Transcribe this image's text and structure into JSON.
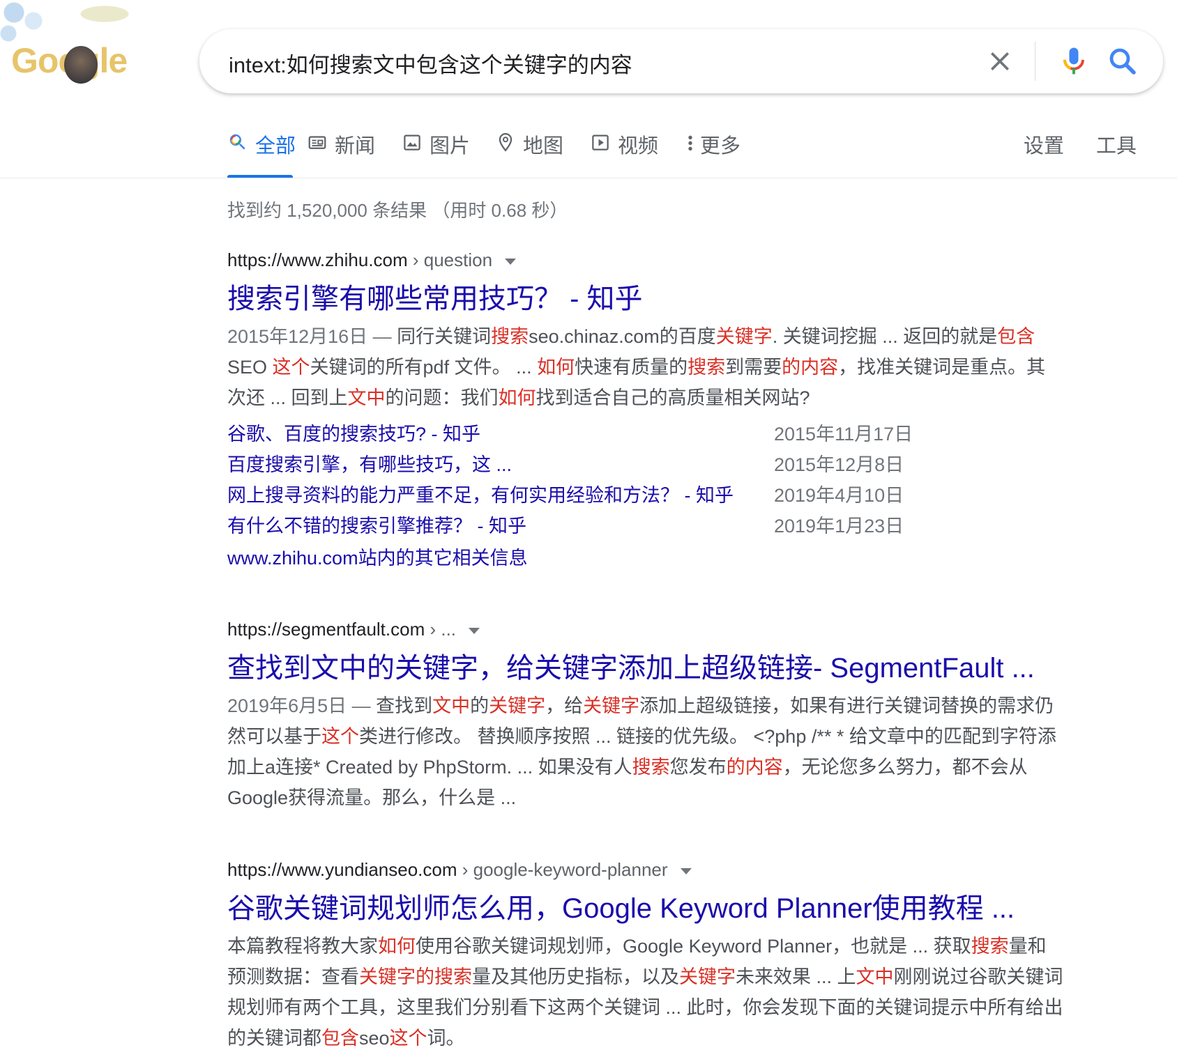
{
  "logo": {
    "text": "Google"
  },
  "search": {
    "query": "intext:如何搜索文中包含这个关键字的内容",
    "clear_icon": "close-icon",
    "mic_icon": "mic-icon",
    "search_icon": "search-icon"
  },
  "tabs": [
    {
      "label": "全部",
      "icon": "search-icon",
      "active": true
    },
    {
      "label": "新闻",
      "icon": "newspaper-icon"
    },
    {
      "label": "图片",
      "icon": "image-icon"
    },
    {
      "label": "地图",
      "icon": "map-pin-icon"
    },
    {
      "label": "视频",
      "icon": "play-icon"
    },
    {
      "label": "更多",
      "icon": "more-vert-icon"
    }
  ],
  "tools": {
    "settings": "设置",
    "tools": "工具"
  },
  "stats": "找到约 1,520,000 条结果 （用时 0.68 秒）",
  "colors": {
    "link": "#1a0dab",
    "highlight": "#d93025",
    "accent": "#1a73e8"
  },
  "results": [
    {
      "site": "https://www.zhihu.com",
      "path": " › question",
      "title": "搜索引擎有哪些常用技巧？ - 知乎",
      "date": "2015年12月16日 — ",
      "snippet_parts": [
        {
          "t": "同行关键词"
        },
        {
          "t": "搜索",
          "hl": true
        },
        {
          "t": "seo.chinaz.com的百度"
        },
        {
          "t": "关键字",
          "hl": true
        },
        {
          "t": ". 关键词挖掘 ... 返回的就是"
        },
        {
          "t": "包含",
          "hl": true
        },
        {
          "t": "SEO "
        },
        {
          "t": "这个",
          "hl": true
        },
        {
          "t": "关键词的所有pdf 文件。 ... "
        },
        {
          "t": "如何",
          "hl": true
        },
        {
          "t": "快速有质量的"
        },
        {
          "t": "搜索",
          "hl": true
        },
        {
          "t": "到需要"
        },
        {
          "t": "的内容",
          "hl": true
        },
        {
          "t": "，找准关键词是重点。其次还 ... 回到上"
        },
        {
          "t": "文中",
          "hl": true
        },
        {
          "t": "的问题：我们"
        },
        {
          "t": "如何",
          "hl": true
        },
        {
          "t": "找到适合自己的高质量相关网站?"
        }
      ],
      "sitelinks": [
        {
          "title": "谷歌、百度的搜索技巧? - 知乎",
          "date": "2015年11月17日"
        },
        {
          "title": "百度搜索引擎，有哪些技巧，这 ...",
          "date": "2015年12月8日"
        },
        {
          "title": "网上搜寻资料的能力严重不足，有何实用经验和方法？ - 知乎",
          "date": "2019年4月10日"
        },
        {
          "title": "有什么不错的搜索引擎推荐？ - 知乎",
          "date": "2019年1月23日"
        }
      ],
      "more": "www.zhihu.com站内的其它相关信息"
    },
    {
      "site": "https://segmentfault.com",
      "path": " › ...",
      "title": "查找到文中的关键字，给关键字添加上超级链接- SegmentFault ...",
      "date": "2019年6月5日 — ",
      "snippet_parts": [
        {
          "t": "查找到"
        },
        {
          "t": "文中",
          "hl": true
        },
        {
          "t": "的"
        },
        {
          "t": "关键字",
          "hl": true
        },
        {
          "t": "，给"
        },
        {
          "t": "关键字",
          "hl": true
        },
        {
          "t": "添加上超级链接，如果有进行关键词替换的需求仍然可以基于"
        },
        {
          "t": "这个",
          "hl": true
        },
        {
          "t": "类进行修改。 替换顺序按照 ... 链接的优先级。 <?php /** * 给文章中的匹配到字符添加上a连接* Created by PhpStorm. ... 如果没有人"
        },
        {
          "t": "搜索",
          "hl": true
        },
        {
          "t": "您发布"
        },
        {
          "t": "的内容",
          "hl": true
        },
        {
          "t": "，无论您多么努力，都不会从Google获得流量。那么，什么是 ..."
        }
      ]
    },
    {
      "site": "https://www.yundianseo.com",
      "path": " › google-keyword-planner",
      "title": "谷歌关键词规划师怎么用，Google Keyword Planner使用教程 ...",
      "date": "",
      "snippet_parts": [
        {
          "t": "本篇教程将教大家"
        },
        {
          "t": "如何",
          "hl": true
        },
        {
          "t": "使用谷歌关键词规划师，Google Keyword Planner，也就是 ... 获取"
        },
        {
          "t": "搜索",
          "hl": true
        },
        {
          "t": "量和预测数据：查看"
        },
        {
          "t": "关键字的搜索",
          "hl": true
        },
        {
          "t": "量及其他历史指标，以及"
        },
        {
          "t": "关键字",
          "hl": true
        },
        {
          "t": "未来效果 ... 上"
        },
        {
          "t": "文中",
          "hl": true
        },
        {
          "t": "刚刚说过谷歌关键词规划师有两个工具，这里我们分别看下这两个关键词 ... 此时，你会发现下面的关键词提示中所有给出的关键词都"
        },
        {
          "t": "包含",
          "hl": true
        },
        {
          "t": "seo"
        },
        {
          "t": "这个",
          "hl": true
        },
        {
          "t": "词。"
        }
      ]
    }
  ]
}
